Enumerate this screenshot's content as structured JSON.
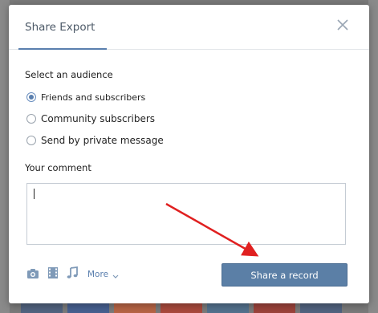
{
  "dialog": {
    "title": "Share Export"
  },
  "audience": {
    "label": "Select an audience",
    "options": [
      {
        "label": "Friends and subscribers",
        "selected": true
      },
      {
        "label": "Community subscribers",
        "selected": false
      },
      {
        "label": "Send by private message",
        "selected": false
      }
    ]
  },
  "comment": {
    "label": "Your comment",
    "value": ""
  },
  "toolbar": {
    "icons": [
      "camera-icon",
      "film-icon",
      "music-icon"
    ],
    "more_label": "More"
  },
  "actions": {
    "share_label": "Share a record"
  },
  "colors": {
    "accent": "#5a7fae",
    "button": "#5b7fa6",
    "arrow": "#e02020"
  }
}
